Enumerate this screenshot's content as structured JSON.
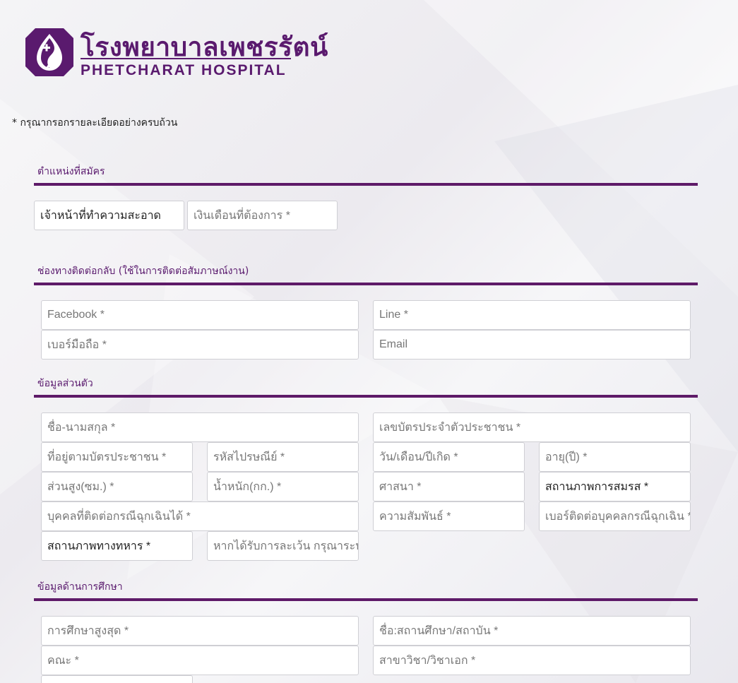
{
  "logo": {
    "thai_name": "โรงพยาบาลเพชรรัตน์",
    "english_name": "PHETCHARAT HOSPITAL"
  },
  "note": "* กรุณากรอกรายละเอียดอย่างครบถ้วน",
  "sections": {
    "position": {
      "title": "ตำแหน่งที่สมัคร",
      "position_value": "เจ้าหน้าที่ทำความสะอาด",
      "salary_placeholder": "เงินเดือนที่ต้องการ *"
    },
    "contact": {
      "title": "ช่องทางติดต่อกลับ (ใช้ในการติดต่อสัมภาษณ์งาน)",
      "facebook_placeholder": "Facebook *",
      "line_placeholder": "Line *",
      "mobile_placeholder": "เบอร์มือถือ *",
      "email_placeholder": "Email"
    },
    "personal": {
      "title": "ข้อมูลส่วนตัว",
      "fullname_placeholder": "ชื่อ-นามสกุล *",
      "id_card_placeholder": "เลขบัตรประจำตัวประชาชน *",
      "address_placeholder": "ที่อยู่ตามบัตรประชาชน *",
      "postcode_placeholder": "รหัสไปรษณีย์ *",
      "birthdate_placeholder": "วัน/เดือน/ปีเกิด *",
      "age_placeholder": "อายุ(ปี) *",
      "height_placeholder": "ส่วนสูง(ซม.) *",
      "weight_placeholder": "น้ำหนัก(กก.) *",
      "religion_placeholder": "ศาสนา *",
      "marital_status_label": "สถานภาพการสมรส *",
      "emergency_contact_placeholder": "บุคคลที่ติดต่อกรณีฉุกเฉินได้ *",
      "relationship_placeholder": "ความสัมพันธ์ *",
      "emergency_phone_placeholder": "เบอร์ติดต่อบุคคลกรณีฉุกเฉิน *",
      "military_status_label": "สถานภาพทางทหาร *",
      "exemption_placeholder": "หากได้รับการละเว้น กรุณาระบุเ"
    },
    "education": {
      "title": "ข้อมูลด้านการศึกษา",
      "highest_education_placeholder": "การศึกษาสูงสุด *",
      "institution_placeholder": "ชื่อ:สถานศึกษา/สถาบัน *",
      "faculty_placeholder": "คณะ *",
      "major_placeholder": "สาขาวิชา/วิชาเอก *"
    }
  },
  "colors": {
    "brand": "#5a1a6e",
    "section_line": "#5e1a68"
  },
  "icons": [
    "hospital-logo-icon"
  ]
}
